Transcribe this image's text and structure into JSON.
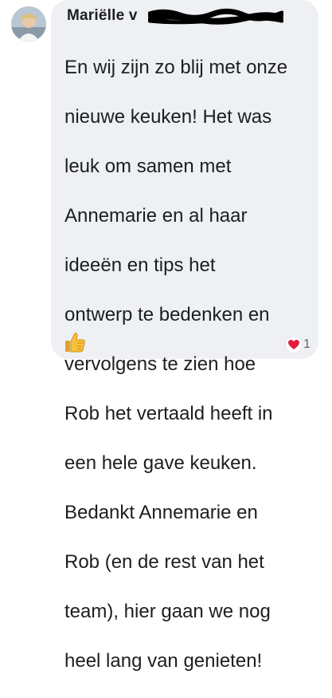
{
  "comment": {
    "author": "Mariëlle v",
    "lines": [
      "En wij zijn zo blij met onze",
      "nieuwe keuken! Het was",
      "leuk om samen met",
      "Annemarie en al haar",
      "ideeën en tips het",
      "ontwerp te bedenken en",
      "vervolgens te zien hoe",
      "Rob het vertaald heeft in",
      "een hele gave keuken.",
      "Bedankt Annemarie en",
      "Rob (en de rest van het",
      "team), hier gaan we nog",
      "heel lang van genieten!"
    ],
    "emoji_icon": "thumbs-up-icon",
    "reactions": {
      "icon": "heart-icon",
      "count": "1"
    }
  },
  "colors": {
    "bubble": "#eef0f3",
    "text": "#1c1e21",
    "heart": "#e41e3f"
  }
}
